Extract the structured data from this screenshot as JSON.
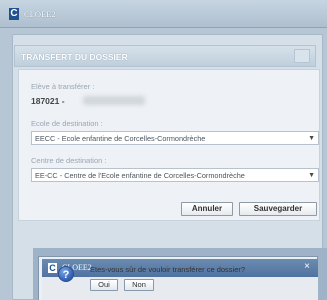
{
  "app": {
    "logo": "C",
    "title": "CLOEE2"
  },
  "dialog": {
    "title": "TRANSFERT DU DOSSIER",
    "student_label": "Elève à transférer :",
    "student_id": "187021 -",
    "school_label": "Ecole de destination :",
    "school_value": "EECC - Ecole enfantine de Corcelles-Cormondrèche",
    "center_label": "Centre de destination :",
    "center_value": "EE-CC - Centre de l'Ecole enfantine de Corcelles-Cormondrèche",
    "cancel_label": "Annuler",
    "save_label": "Sauvegarder"
  },
  "confirm": {
    "logo": "C",
    "title": "CLOEE2",
    "close": "×",
    "question_icon": "?",
    "message": "Etes-vous sûr de vouloir transférer ce dossier?",
    "yes_label": "Oui",
    "no_label": "Non"
  },
  "icons": {
    "dropdown": "chevron-down-icon",
    "question": "question-icon",
    "close": "close-icon"
  },
  "colors": {
    "accent": "#20508e",
    "title_bar": "#4f72a0"
  }
}
